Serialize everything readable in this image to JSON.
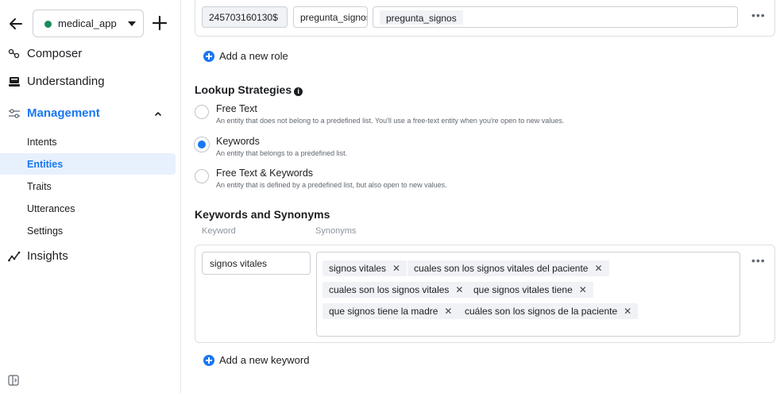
{
  "sidebar": {
    "app_name": "medical_app",
    "colors": {
      "app_dot": "#1b8c5a",
      "accent": "#1877f2",
      "active_bg": "#e7f0fd"
    },
    "nav": [
      {
        "label": "Composer",
        "icon": "composer-icon"
      },
      {
        "label": "Understanding",
        "icon": "understanding-icon"
      },
      {
        "label": "Management",
        "icon": "management-icon",
        "active": true,
        "expanded": true
      },
      {
        "label": "Insights",
        "icon": "insights-icon"
      }
    ],
    "sub_items": [
      {
        "label": "Intents"
      },
      {
        "label": "Entities",
        "active": true
      },
      {
        "label": "Traits"
      },
      {
        "label": "Utterances"
      },
      {
        "label": "Settings"
      }
    ]
  },
  "roles": {
    "row": {
      "id": "245703160130$",
      "name": "pregunta_signos",
      "tag": "pregunta_signos"
    },
    "add_label": "Add a new role"
  },
  "lookup": {
    "title": "Lookup Strategies",
    "options": [
      {
        "title": "Free Text",
        "desc": "An entity that does not belong to a predefined list. You'll use a free-text entity when you're open to new values.",
        "checked": false
      },
      {
        "title": "Keywords",
        "desc": "An entity that belongs to a predefined list.",
        "checked": true
      },
      {
        "title": "Free Text & Keywords",
        "desc": "An entity that is defined by a predefined list, but also open to new values.",
        "checked": false
      }
    ]
  },
  "keywords": {
    "title": "Keywords and Synonyms",
    "col_keyword": "Keyword",
    "col_synonyms": "Synonyms",
    "row": {
      "keyword": "signos vitales",
      "synonyms": [
        "signos vitales",
        "cuales son los signos vitales del paciente",
        "cuales son los signos vitales",
        "que signos vitales tiene",
        "que signos tiene la madre",
        "cuáles son los signos de la paciente"
      ]
    },
    "add_label": "Add a new keyword"
  }
}
